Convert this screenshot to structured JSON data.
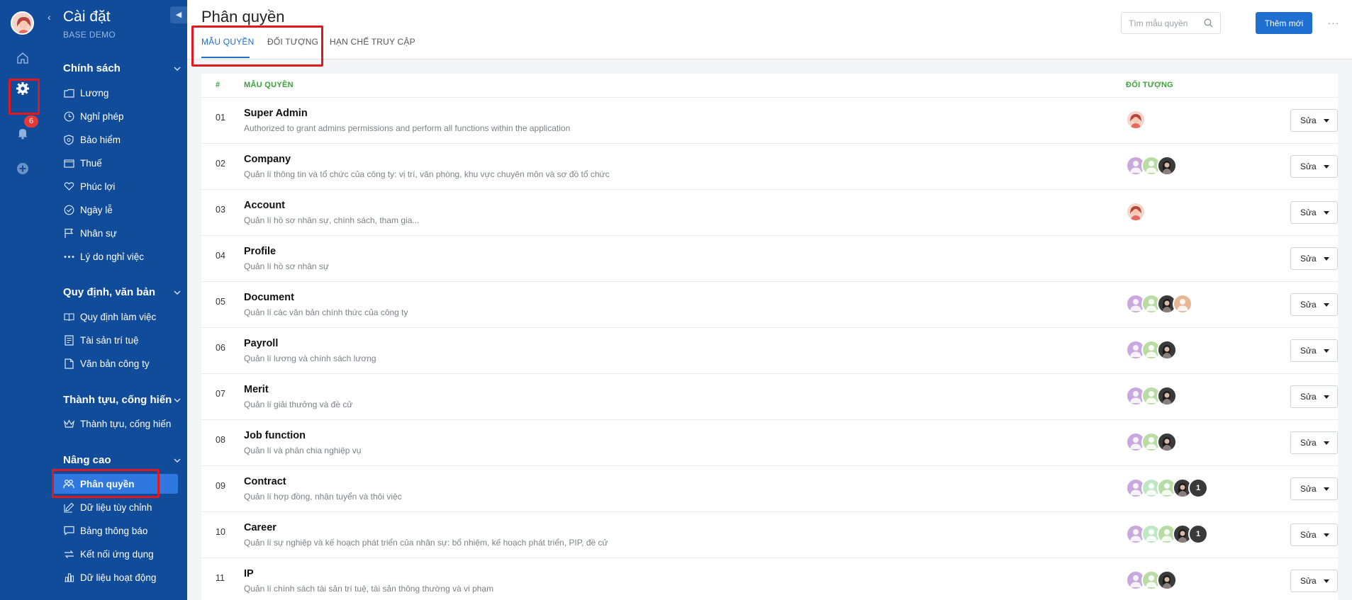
{
  "rail": {
    "notification_count": "6"
  },
  "side": {
    "title": "Cài đặt",
    "subtitle": "BASE DEMO",
    "sections": [
      {
        "title": "Chính sách",
        "items": [
          {
            "label": "Lương",
            "icon": "folder-icon"
          },
          {
            "label": "Nghỉ phép",
            "icon": "clock-icon"
          },
          {
            "label": "Bảo hiểm",
            "icon": "shield-icon"
          },
          {
            "label": "Thuế",
            "icon": "wallet-icon"
          },
          {
            "label": "Phúc lợi",
            "icon": "heart-hand-icon"
          },
          {
            "label": "Ngày lễ",
            "icon": "check-circle-icon"
          },
          {
            "label": "Nhân sự",
            "icon": "flag-icon"
          },
          {
            "label": "Lý do nghỉ việc",
            "icon": "dots-icon"
          }
        ]
      },
      {
        "title": "Quy định, văn bản",
        "items": [
          {
            "label": "Quy định làm việc",
            "icon": "book-icon"
          },
          {
            "label": "Tài sản trí tuệ",
            "icon": "document-icon"
          },
          {
            "label": "Văn bản công ty",
            "icon": "file-icon"
          }
        ]
      },
      {
        "title": "Thành tựu, cống hiến",
        "items": [
          {
            "label": "Thành tựu, cống hiến",
            "icon": "crown-icon"
          }
        ]
      },
      {
        "title": "Nâng cao",
        "items": [
          {
            "label": "Phân quyền",
            "icon": "users-icon",
            "active": true
          },
          {
            "label": "Dữ liệu tùy chỉnh",
            "icon": "edit-icon"
          },
          {
            "label": "Bảng thông báo",
            "icon": "message-icon"
          },
          {
            "label": "Kết nối ứng dụng",
            "icon": "link-icon"
          },
          {
            "label": "Dữ liệu hoạt động",
            "icon": "chart-icon"
          }
        ]
      }
    ]
  },
  "header": {
    "title": "Phân quyền",
    "tabs": [
      {
        "label": "MẪU QUYỀN",
        "active": true
      },
      {
        "label": "ĐỐI TƯỢNG",
        "active": false
      },
      {
        "label": "HẠN CHẾ TRUY CẬP",
        "active": false
      }
    ],
    "search_placeholder": "Tìm mẫu quyền",
    "add_label": "Thêm mới",
    "more_label": "···"
  },
  "table": {
    "columns": {
      "index": "#",
      "name": "MẪU QUYỀN",
      "target": "ĐỐI TƯỢNG"
    },
    "edit_label": "Sửa",
    "rows": [
      {
        "num": "01",
        "name": "Super Admin",
        "desc": "Authorized to grant admins permissions and perform all functions within the application",
        "avatars": [
          "girl"
        ]
      },
      {
        "num": "02",
        "name": "Company",
        "desc": "Quản lí thông tin và tổ chức của công ty: vị trí, văn phòng, khu vực chuyên môn và sơ đồ tổ chức",
        "avatars": [
          "purple",
          "green",
          "dark"
        ]
      },
      {
        "num": "03",
        "name": "Account",
        "desc": "Quản lí hồ sơ nhân sự, chính sách, tham gia...",
        "avatars": [
          "girl"
        ]
      },
      {
        "num": "04",
        "name": "Profile",
        "desc": "Quản lí hồ sơ nhân sự",
        "avatars": []
      },
      {
        "num": "05",
        "name": "Document",
        "desc": "Quản lí các văn bản chính thức của công ty",
        "avatars": [
          "purple",
          "green",
          "dark",
          "tan"
        ]
      },
      {
        "num": "06",
        "name": "Payroll",
        "desc": "Quản lí lương và chính sách lương",
        "avatars": [
          "purple",
          "green",
          "dark"
        ]
      },
      {
        "num": "07",
        "name": "Merit",
        "desc": "Quản lí giải thưởng và đề cử",
        "avatars": [
          "purple",
          "green",
          "dark"
        ]
      },
      {
        "num": "08",
        "name": "Job function",
        "desc": "Quản lí và phân chia nghiệp vụ",
        "avatars": [
          "purple",
          "green",
          "dark"
        ]
      },
      {
        "num": "09",
        "name": "Contract",
        "desc": "Quản lí hợp đồng, nhận tuyển và thôi việc",
        "avatars": [
          "purple",
          "mint",
          "green",
          "dark"
        ],
        "extra": "1"
      },
      {
        "num": "10",
        "name": "Career",
        "desc": "Quản lí sự nghiệp và kế hoạch phát triển của nhân sự: bổ nhiệm, kế hoạch phát triển, PIP, đề cử",
        "avatars": [
          "purple",
          "mint",
          "green",
          "dark"
        ],
        "extra": "1"
      },
      {
        "num": "11",
        "name": "IP",
        "desc": "Quản lí chính sách tài sản trí tuệ, tài sản thông thường và vi phạm",
        "avatars": [
          "purple",
          "green",
          "dark"
        ]
      }
    ]
  },
  "colors": {
    "sidebar": "#114c9b",
    "accent": "#1f6fd0",
    "highlight": "#e0191e",
    "header_text": "#3aa33a"
  }
}
